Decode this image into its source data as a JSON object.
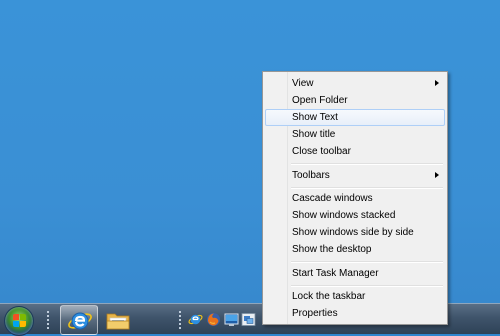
{
  "menu": {
    "items": [
      {
        "label": "View",
        "submenu": true
      },
      {
        "label": "Open Folder"
      },
      {
        "label": "Show Text",
        "highlighted": true
      },
      {
        "label": "Show title"
      },
      {
        "label": "Close toolbar"
      },
      {
        "label": "Toolbars",
        "submenu": true
      },
      {
        "label": "Cascade windows"
      },
      {
        "label": "Show windows stacked"
      },
      {
        "label": "Show windows side by side"
      },
      {
        "label": "Show the desktop"
      },
      {
        "label": "Start Task Manager"
      },
      {
        "label": "Lock the taskbar"
      },
      {
        "label": "Properties"
      }
    ]
  },
  "taskbar": {
    "pinned": [
      "internet-explorer-icon",
      "windows-explorer-icon"
    ],
    "quick_launch": [
      "internet-explorer-icon",
      "firefox-icon",
      "show-desktop-icon",
      "switch-windows-icon"
    ]
  },
  "colors": {
    "desktop": "#3a8fd4",
    "menu_bg": "#f0f0f0",
    "highlight_border": "#aecff7"
  }
}
